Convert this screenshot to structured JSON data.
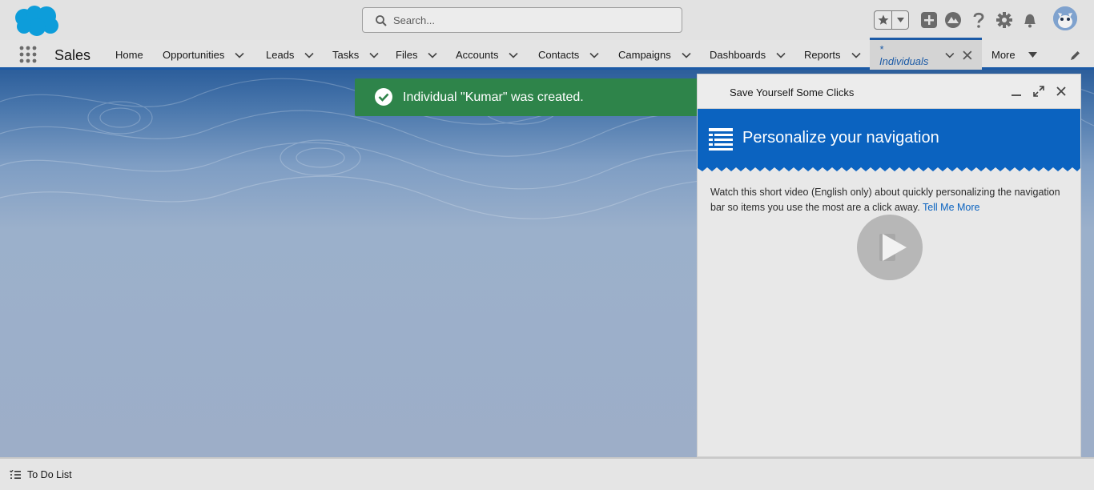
{
  "header": {
    "search_placeholder": "Search..."
  },
  "nav": {
    "app_name": "Sales",
    "items": [
      {
        "label": "Home",
        "has_menu": false
      },
      {
        "label": "Opportunities",
        "has_menu": true
      },
      {
        "label": "Leads",
        "has_menu": true
      },
      {
        "label": "Tasks",
        "has_menu": true
      },
      {
        "label": "Files",
        "has_menu": true
      },
      {
        "label": "Accounts",
        "has_menu": true
      },
      {
        "label": "Contacts",
        "has_menu": true
      },
      {
        "label": "Campaigns",
        "has_menu": true
      },
      {
        "label": "Dashboards",
        "has_menu": true
      },
      {
        "label": "Reports",
        "has_menu": true
      }
    ],
    "active_tab": {
      "label": "* Individuals"
    },
    "more_label": "More"
  },
  "toast": {
    "message": "Individual \"Kumar\" was created.",
    "color": "#2e844a"
  },
  "help_panel": {
    "title": "Save Yourself Some Clicks",
    "banner_title": "Personalize your navigation",
    "body_text": "Watch this short video (English only) about quickly personalizing the navigation bar so items you use the most are a click away.",
    "link_text": "Tell Me More"
  },
  "utility_bar": {
    "todo_label": "To Do List"
  },
  "colors": {
    "brand_blue": "#0b63c0",
    "nav_accent": "#1b5aa6",
    "success": "#2e844a"
  },
  "icons": [
    "salesforce-cloud-logo",
    "search-icon",
    "favorites-star-icon",
    "add-icon",
    "trailhead-icon",
    "help-icon",
    "setup-gear-icon",
    "notifications-bell-icon",
    "app-launcher-icon",
    "edit-pencil-icon",
    "success-check-icon",
    "close-icon",
    "minimize-icon",
    "expand-icon",
    "play-icon",
    "todo-list-icon"
  ]
}
